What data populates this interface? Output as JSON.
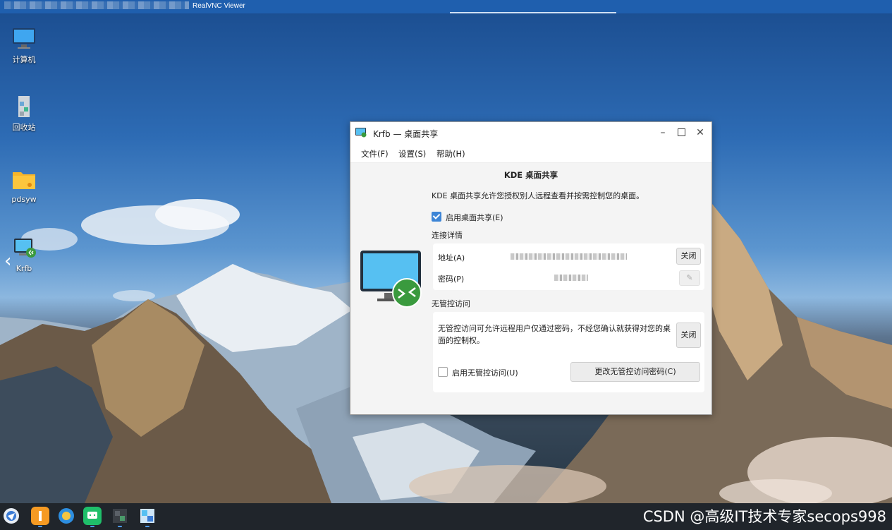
{
  "vnc": {
    "title": "RealVNC Viewer"
  },
  "desktop": {
    "icons": [
      {
        "label": "计算机",
        "icon": "computer-icon"
      },
      {
        "label": "回收站",
        "icon": "recycle-bin-icon"
      },
      {
        "label": "pdsyw",
        "icon": "folder-icon"
      },
      {
        "label": "Krfb",
        "icon": "krfb-app-icon"
      }
    ]
  },
  "window": {
    "title": "Krfb — 桌面共享",
    "menu": [
      "文件(F)",
      "设置(S)",
      "帮助(H)"
    ],
    "heading": "KDE 桌面共享",
    "description": "KDE 桌面共享允许您授权别人远程查看并按需控制您的桌面。",
    "enable_sharing": {
      "label": "启用桌面共享(E)",
      "checked": true
    },
    "connection": {
      "title": "连接详情",
      "address_label": "地址(A)",
      "address_value": "",
      "password_label": "密码(P)",
      "password_value": "",
      "close_button": "关闭"
    },
    "unattended": {
      "title": "无管控访问",
      "description": "无管控访问可允许远程用户仅通过密码，不经您确认就获得对您的桌面的控制权。",
      "close_button": "关闭",
      "enable": {
        "label": "启用无管控访问(U)",
        "checked": false
      },
      "change_password_button": "更改无管控访问密码(C)"
    }
  },
  "taskbar": {
    "apps": [
      "start-menu-icon",
      "file-manager-icon",
      "browser-icon",
      "wechat-icon",
      "terminal-icon",
      "krfb-taskbar-icon"
    ],
    "watermark": "CSDN @高级IT技术专家secops998"
  },
  "colors": {
    "accent": "#3d85d6",
    "vnc_bar": "#1f5fae",
    "taskbar": "#20252b"
  }
}
